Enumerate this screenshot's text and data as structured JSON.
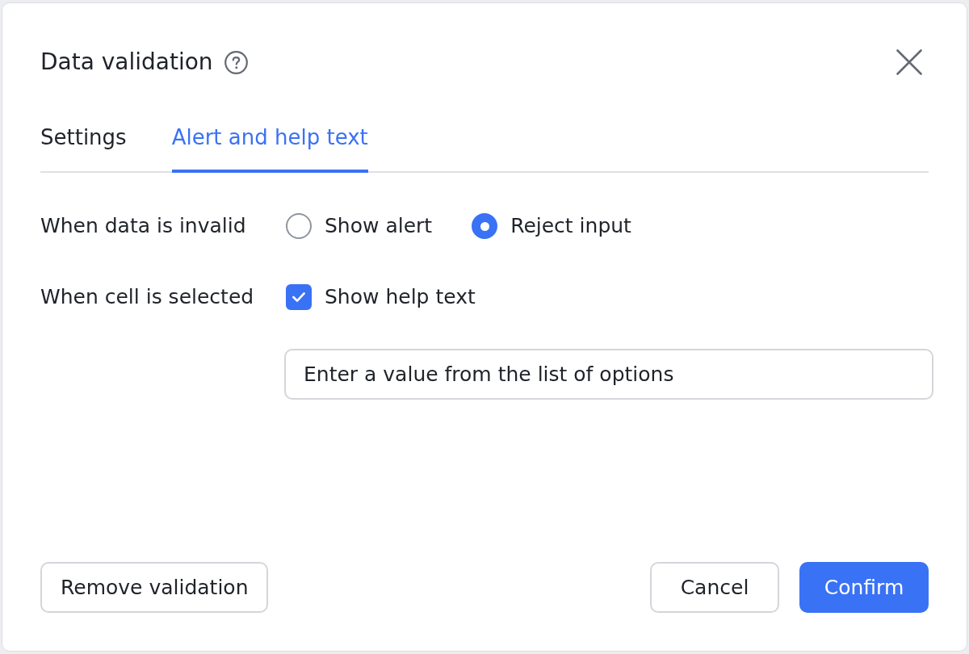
{
  "dialog": {
    "title": "Data validation"
  },
  "tabs": [
    {
      "label": "Settings",
      "selected": false
    },
    {
      "label": "Alert and help text",
      "selected": true
    }
  ],
  "fields": [
    {
      "kind": "radio_group",
      "label": "When data is invalid",
      "options": [
        {
          "label": "Show alert",
          "selected": false
        },
        {
          "label": "Reject input",
          "selected": true
        }
      ]
    },
    {
      "kind": "checkbox",
      "label": "When cell is selected",
      "option": {
        "label": "Show help text",
        "checked": true
      },
      "help_text": {
        "value": "Enter a value from the list of options"
      }
    }
  ],
  "footer": {
    "left_buttons": [
      {
        "label": "Remove validation",
        "kind": "secondary"
      }
    ],
    "right_buttons": [
      {
        "label": "Cancel",
        "kind": "secondary"
      },
      {
        "label": "Confirm",
        "kind": "primary"
      }
    ]
  }
}
